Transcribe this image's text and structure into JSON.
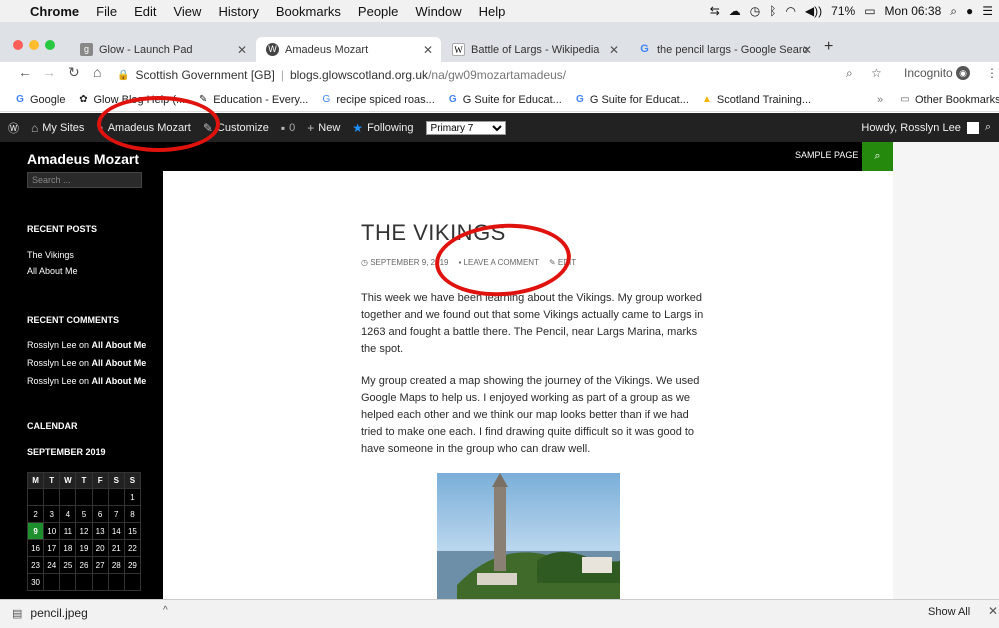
{
  "menubar": {
    "app": "Chrome",
    "items": [
      "File",
      "Edit",
      "View",
      "History",
      "Bookmarks",
      "People",
      "Window",
      "Help"
    ],
    "battery": "71%",
    "clock": "Mon 06:38"
  },
  "tabs": [
    {
      "label": "Glow - Launch Pad",
      "favicon": "glow"
    },
    {
      "label": "Amadeus Mozart",
      "favicon": "wordpress"
    },
    {
      "label": "Battle of Largs - Wikipedia",
      "favicon": "W"
    },
    {
      "label": "the pencil largs - Google Searc",
      "favicon": "G"
    }
  ],
  "address": {
    "security": "Scottish Government [GB]",
    "domain": "blogs.glowscotland.org.uk",
    "path": "/na/gw09mozartamadeus/",
    "incognito": "Incognito"
  },
  "bookmarks": {
    "items": [
      "Google",
      "Glow Blog Help (...",
      "Education - Every...",
      "recipe spiced roas...",
      "G Suite for Educat...",
      "G Suite for Educat...",
      "Scotland Training..."
    ],
    "more": "»",
    "other": "Other Bookmarks"
  },
  "adminbar": {
    "mysites": "My Sites",
    "site": "Amadeus Mozart",
    "customize": "Customize",
    "comments": "0",
    "new": "New",
    "following": "Following",
    "select": "Primary 7",
    "howdy": "Howdy, Rosslyn Lee"
  },
  "site": {
    "title": "Amadeus Mozart",
    "search_placeholder": "Search ...",
    "sample_page": "SAMPLE PAGE"
  },
  "sidebar": {
    "recent_posts_title": "RECENT POSTS",
    "recent_posts": [
      "The Vikings",
      "All About Me"
    ],
    "recent_comments_title": "RECENT COMMENTS",
    "comments": [
      {
        "author": "Rosslyn Lee",
        "on": " on ",
        "post": "All About Me"
      },
      {
        "author": "Rosslyn Lee",
        "on": " on ",
        "post": "All About Me"
      },
      {
        "author": "Rosslyn Lee",
        "on": " on ",
        "post": "All About Me"
      }
    ],
    "calendar_title": "CALENDAR",
    "month": "SEPTEMBER 2019",
    "weekdays": [
      "M",
      "T",
      "W",
      "T",
      "F",
      "S",
      "S"
    ],
    "weeks": [
      [
        "",
        "",
        "",
        "",
        "",
        "",
        "1"
      ],
      [
        "2",
        "3",
        "4",
        "5",
        "6",
        "7",
        "8"
      ],
      [
        "9",
        "10",
        "11",
        "12",
        "13",
        "14",
        "15"
      ],
      [
        "16",
        "17",
        "18",
        "19",
        "20",
        "21",
        "22"
      ],
      [
        "23",
        "24",
        "25",
        "26",
        "27",
        "28",
        "29"
      ],
      [
        "30",
        "",
        "",
        "",
        "",
        "",
        ""
      ]
    ],
    "today": "9"
  },
  "post": {
    "title": "THE VIKINGS",
    "date": "SEPTEMBER 9, 2019",
    "comment": "LEAVE A COMMENT",
    "edit": "EDIT",
    "paragraph1": "This week we have been learning about the Vikings.  My group worked together and we found out that some Vikings actually came to Largs in 1263 and fought a battle there.  The Pencil, near Largs Marina, marks the spot.",
    "paragraph2": "My group created a map showing the journey of the Vikings.  We used Google Maps to help us.  I enjoyed working as part of a group as we helped each other and we think our map looks better than if we had tried to make one each.  I find drawing quite difficult so it was good to have someone in the group who can draw well."
  },
  "download": {
    "file": "pencil.jpeg",
    "show_all": "Show All"
  },
  "colors": {
    "annotation": "#e0120e",
    "accent": "#24890d"
  }
}
